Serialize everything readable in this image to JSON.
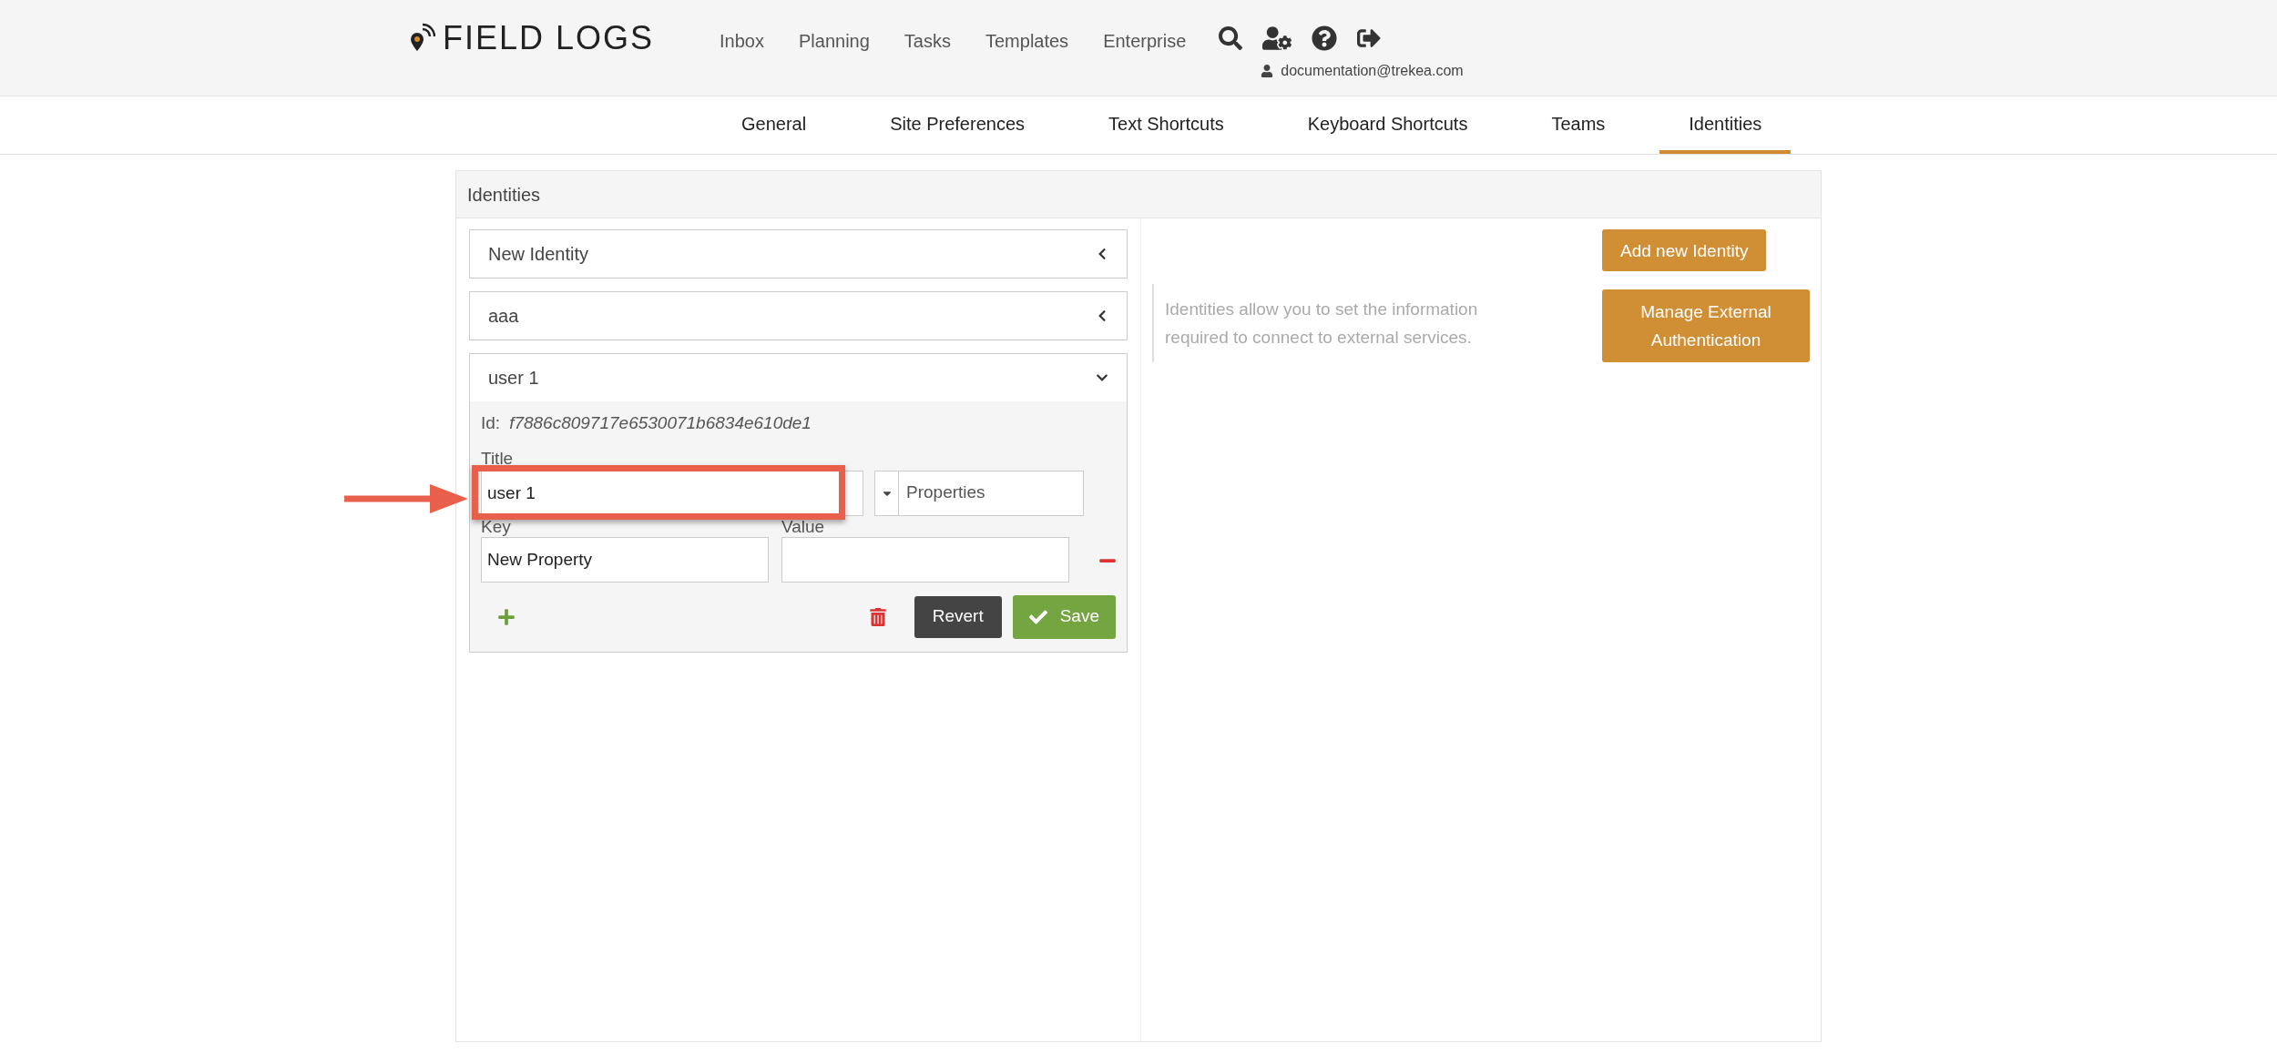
{
  "header": {
    "logo": "FIELD LOGS",
    "nav": [
      "Inbox",
      "Planning",
      "Tasks",
      "Templates",
      "Enterprise"
    ],
    "user_email": "documentation@trekea.com"
  },
  "settings_tabs": [
    {
      "label": "General",
      "selected": false
    },
    {
      "label": "Site Preferences",
      "selected": false
    },
    {
      "label": "Text Shortcuts",
      "selected": false
    },
    {
      "label": "Keyboard Shortcuts",
      "selected": false
    },
    {
      "label": "Teams",
      "selected": false
    },
    {
      "label": "Identities",
      "selected": true
    }
  ],
  "panel": {
    "title": "Identities",
    "identities": [
      {
        "name": "New Identity",
        "expanded": false
      },
      {
        "name": "aaa",
        "expanded": false
      },
      {
        "name": "user 1",
        "expanded": true
      }
    ],
    "detail": {
      "id_label": "Id:",
      "id_value": "f7886c809717e6530071b6834e610de1",
      "title_label": "Title",
      "title_value": "user 1",
      "select_value": "Properties",
      "key_label": "Key",
      "value_label": "Value",
      "key_value": "New Property",
      "revert": "Revert",
      "save": "Save"
    },
    "description": "Identities allow you to set the information required to connect to external services.",
    "buttons": [
      "Add new Identity",
      "Manage External Authentication"
    ]
  }
}
